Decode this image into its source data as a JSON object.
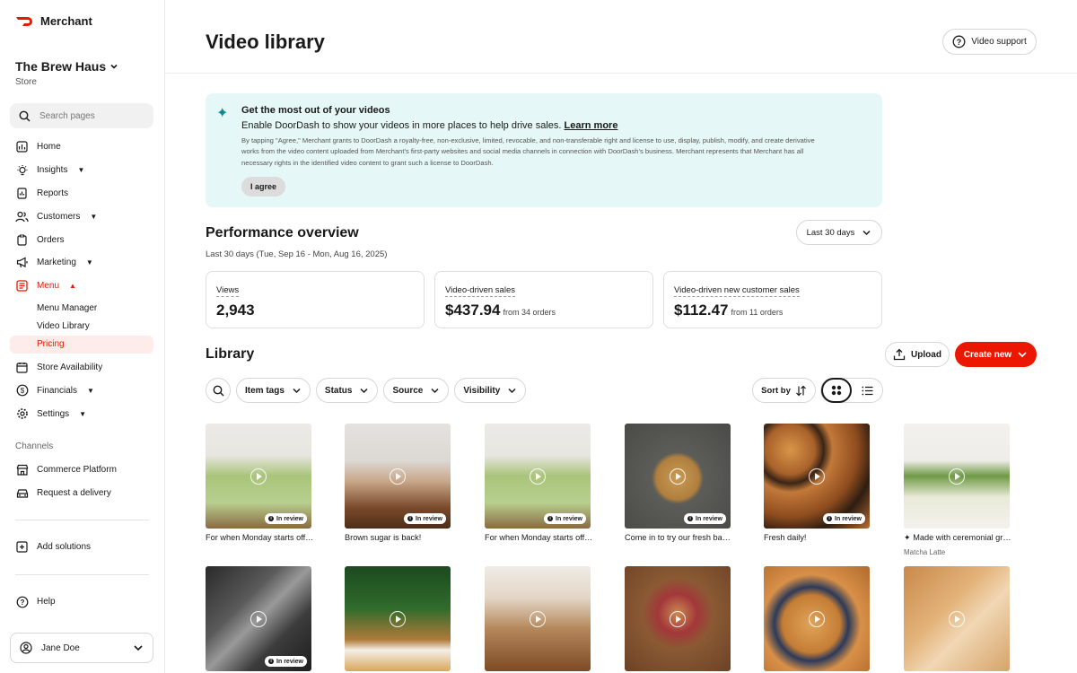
{
  "brand": {
    "name": "Merchant",
    "color": "#eb1700"
  },
  "store": {
    "name": "The Brew Haus",
    "type": "Store"
  },
  "search": {
    "placeholder": "Search pages"
  },
  "nav": {
    "items": [
      {
        "label": "Home",
        "icon": "home-icon"
      },
      {
        "label": "Insights",
        "icon": "bulb-icon"
      },
      {
        "label": "Reports",
        "icon": "report-icon"
      },
      {
        "label": "Customers",
        "icon": "customers-icon"
      },
      {
        "label": "Orders",
        "icon": "orders-icon"
      },
      {
        "label": "Marketing",
        "icon": "megaphone-icon"
      },
      {
        "label": "Menu",
        "icon": "menu-icon"
      }
    ],
    "menu_sub": [
      "Menu Manager",
      "Video Library",
      "Pricing"
    ],
    "items2": [
      {
        "label": "Store Availability",
        "icon": "calendar-icon"
      },
      {
        "label": "Financials",
        "icon": "dollar-icon"
      },
      {
        "label": "Settings",
        "icon": "gear-icon"
      }
    ],
    "channels_label": "Channels",
    "channels": [
      {
        "label": "Commerce Platform",
        "icon": "storefront-icon"
      },
      {
        "label": "Request a delivery",
        "icon": "car-icon"
      }
    ],
    "add_solutions": "Add solutions",
    "help": "Help",
    "user": "Jane Doe"
  },
  "header": {
    "title": "Video library",
    "support_label": "Video support"
  },
  "banner": {
    "title": "Get the most out of your videos",
    "subtitle": "Enable DoorDash to show your videos in more places to help drive sales.",
    "link": "Learn more",
    "legal": "By tapping \"Agree,\" Merchant grants to DoorDash a royalty-free, non-exclusive, limited, revocable, and non-transferable right and license to use, display, publish, modify, and create derivative works from the video content uploaded from Merchant's first-party websites and social media channels in connection with DoorDash's business. Merchant represents that Merchant has all necessary rights in the identified video content to grant such a license to DoorDash.",
    "agree_label": "I agree"
  },
  "performance": {
    "title": "Performance overview",
    "subtitle": "Last 30 days (Tue, Sep 16 - Mon, Aug 16, 2025)",
    "range": "Last 30 days",
    "cards": [
      {
        "label": "Views",
        "value": "2,943",
        "note": ""
      },
      {
        "label": "Video-driven sales",
        "value": "$437.94",
        "note": "from 34 orders"
      },
      {
        "label": "Video-driven new customer sales",
        "value": "$112.47",
        "note": "from 11 orders"
      }
    ]
  },
  "library": {
    "title": "Library",
    "upload_label": "Upload",
    "create_label": "Create new",
    "filters": [
      "Item tags",
      "Status",
      "Source",
      "Visibility"
    ],
    "sort_label": "Sort by",
    "videos": [
      {
        "caption": "For when Monday starts off right",
        "status": "In review",
        "sub": ""
      },
      {
        "caption": "Brown sugar is back!",
        "status": "In review",
        "sub": ""
      },
      {
        "caption": "For when Monday starts off right",
        "status": "In review",
        "sub": ""
      },
      {
        "caption": "Come in to try our fresh bagels",
        "status": "In review",
        "sub": ""
      },
      {
        "caption": "Fresh daily!",
        "status": "In review",
        "sub": ""
      },
      {
        "caption": "✦ Made with ceremonial grade matcha",
        "status": "",
        "sub": "Matcha Latte"
      },
      {
        "caption": "",
        "status": "In review",
        "sub": ""
      },
      {
        "caption": "",
        "status": "",
        "sub": ""
      },
      {
        "caption": "",
        "status": "",
        "sub": ""
      },
      {
        "caption": "",
        "status": "",
        "sub": ""
      },
      {
        "caption": "",
        "status": "",
        "sub": ""
      },
      {
        "caption": "",
        "status": "",
        "sub": ""
      }
    ]
  }
}
